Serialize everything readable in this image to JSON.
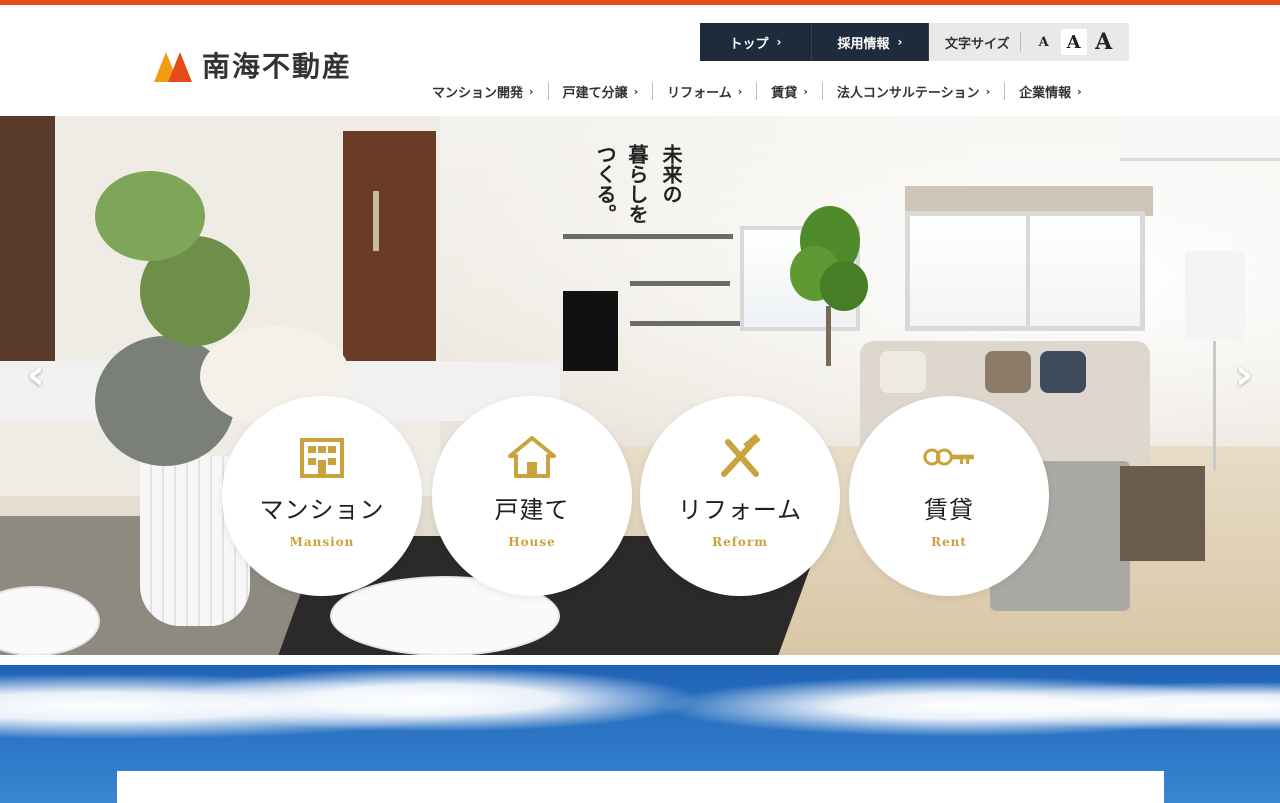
{
  "header": {
    "logo_text": "南海不動産",
    "utility": {
      "top_label": "トップ",
      "recruit_label": "採用情報",
      "fontsize_label": "文字サイズ",
      "size_small": "A",
      "size_medium": "A",
      "size_large": "A"
    },
    "nav": [
      {
        "label": "マンション開発"
      },
      {
        "label": "戸建て分譲"
      },
      {
        "label": "リフォーム"
      },
      {
        "label": "賃貸"
      },
      {
        "label": "法人コンサルテーション"
      },
      {
        "label": "企業情報"
      }
    ],
    "chevron": "›"
  },
  "hero": {
    "tagline_lines": [
      "つくる。",
      "暮らしを",
      "未来の"
    ],
    "prev_arrow": "‹",
    "next_arrow": "›",
    "categories": [
      {
        "title": "マンション",
        "subtitle": "Mansion",
        "icon": "building-icon"
      },
      {
        "title": "戸建て",
        "subtitle": "House",
        "icon": "house-icon"
      },
      {
        "title": "リフォーム",
        "subtitle": "Reform",
        "icon": "tools-icon"
      },
      {
        "title": "賃貸",
        "subtitle": "Rent",
        "icon": "key-icon"
      }
    ]
  },
  "colors": {
    "accent_top": "#e64a19",
    "gold": "#c9a33c",
    "util_bg": "#1e2b3c",
    "sky": "#1f63b7"
  }
}
